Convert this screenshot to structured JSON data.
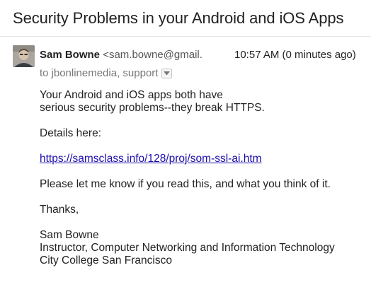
{
  "email": {
    "subject": "Security Problems in your Android and iOS Apps",
    "sender_name": "Sam Bowne",
    "sender_email": "<sam.bowne@gmail.",
    "timestamp": "10:57 AM (0 minutes ago)",
    "recipients_prefix": "to",
    "recipients": "jbonlinemedia, support"
  },
  "body": {
    "line1": "Your Android and iOS apps both have",
    "line2": "serious security problems--they break HTTPS.",
    "details_label": "Details here:",
    "link": "https://samsclass.info/128/proj/som-ssl-ai.htm",
    "request": "Please let me know if you read this, and what you think of it.",
    "closing": "Thanks,",
    "sig_name": "Sam Bowne",
    "sig_title": "Instructor, Computer Networking and Information Technology",
    "sig_org": "City College San Francisco"
  },
  "icons": {
    "avatar": "sender-avatar",
    "details_toggle": "chevron-down-icon"
  }
}
